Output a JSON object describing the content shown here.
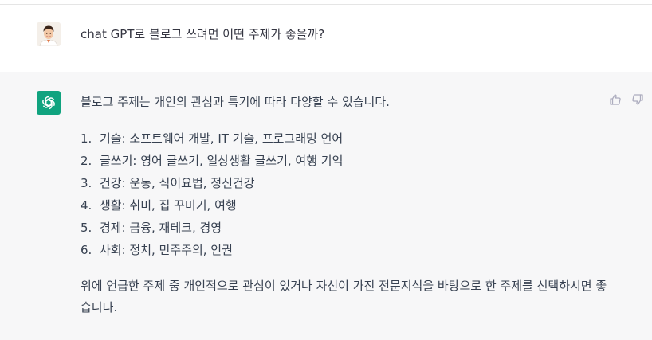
{
  "conversation": {
    "user_message": "chat GPT로 블로그 쓰려면 어떤 주제가 좋을까?",
    "assistant": {
      "intro": "블로그 주제는 개인의 관심과 특기에 따라 다양할 수 있습니다.",
      "list": [
        {
          "num": "1.",
          "text": "기술: 소프트웨어 개발, IT 기술, 프로그래밍 언어"
        },
        {
          "num": "2.",
          "text": "글쓰기: 영어 글쓰기, 일상생활 글쓰기, 여행 기억"
        },
        {
          "num": "3.",
          "text": "건강: 운동, 식이요법, 정신건강"
        },
        {
          "num": "4.",
          "text": "생활: 취미, 집 꾸미기, 여행"
        },
        {
          "num": "5.",
          "text": "경제: 금융, 재테크, 경영"
        },
        {
          "num": "6.",
          "text": "사회: 정치, 민주주의, 인권"
        }
      ],
      "outro": "위에 언급한 주제 중 개인적으로 관심이 있거나 자신이 가진 전문지식을 바탕으로 한 주제를 선택하시면 좋습니다."
    }
  },
  "icons": {
    "user_avatar": "user-avatar",
    "assistant_avatar": "openai-logo-icon",
    "like": "thumbs-up-icon",
    "dislike": "thumbs-down-icon"
  },
  "colors": {
    "assistant_avatar_bg": "#10a37f",
    "assistant_row_bg": "#f7f7f8",
    "text": "#374151"
  }
}
